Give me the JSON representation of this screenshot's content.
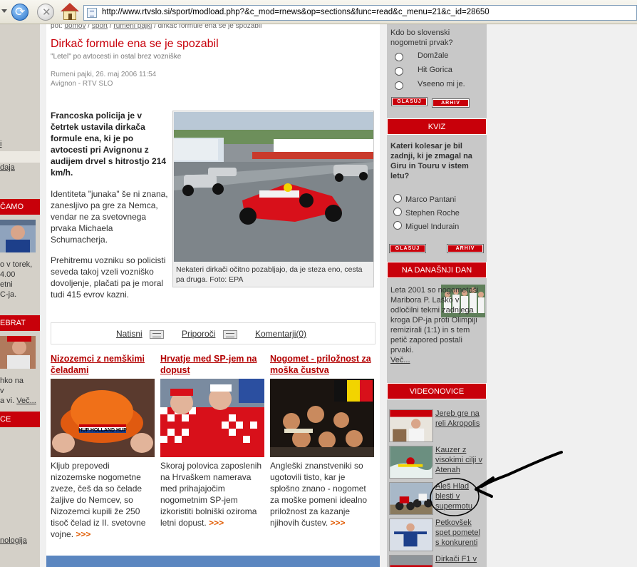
{
  "browser": {
    "url": "http://www.rtvslo.si/sport/modload.php?&c_mod=rnews&op=sections&func=read&c_menu=21&c_id=28650"
  },
  "left": {
    "link1": "i",
    "link2": "daja",
    "bar1": "ČAMO",
    "text1": [
      "o v torek,",
      "4.00",
      "etni",
      "C-ja."
    ],
    "bar2": "EBRAT",
    "text2": [
      "hko na",
      "v",
      "a vi."
    ],
    "text2_more": "Več...",
    "bar3": "CE",
    "link3": "nologija"
  },
  "breadcrumb": {
    "prefix": "pot:",
    "items": [
      "domov",
      "šport",
      "rumeni pajki"
    ],
    "current": "dirkač formule ena se je spozabil"
  },
  "article": {
    "title": "Dirkač formule ena se je spozabil",
    "subtitle": "\"Letel\" po avtocesti in ostal brez vozniške",
    "meta_line1": "Rumeni pajki, 26. maj 2006 11:54",
    "meta_line2": "Avignon - RTV SLO",
    "lead": "Francoska policija je v četrtek ustavila dirkača formule ena, ki je po avtocesti pri Avignonu z audijem drvel s hitrostjo 214 km/h.",
    "p1": "Identiteta \"junaka\" še ni znana, zanesljivo pa gre za Nemca, vendar ne za svetovnega prvaka Michaela Schumacherja.",
    "p2": "Prehitremu vozniku so policisti seveda takoj vzeli vozniško dovoljenje, plačati pa je moral tudi 415 evrov kazni.",
    "caption": "Nekateri dirkači očitno pozabljajo, da je steza eno, cesta pa druga. Foto: EPA"
  },
  "tools": {
    "print": "Natisni",
    "recommend": "Priporoči",
    "comments": "Komentarji(0)"
  },
  "stories": [
    {
      "title": "Nizozemci z nemškimi čeladami",
      "text": "Kljub prepovedi nizozemske nogometne zveze, češ da so čelade žaljive do Nemcev, so Nizozemci kupili že 250 tisoč čelad iz II. svetovne vojne.",
      "more": ">>>",
      "helmet_text": "HUP HOLLAND HUP"
    },
    {
      "title": "Hrvatje med SP-jem na dopust",
      "text": "Skoraj polovica zaposlenih na Hrvaškem namerava med prihajajočim nogometnim SP-jem izkoristiti bolniški oziroma letni dopust.",
      "more": ">>>"
    },
    {
      "title": "Nogomet - priložnost za moška čustva",
      "text": "Angleški znanstveniki so ugotovili tisto, kar je splošno znano - nogomet za moške pomeni idealno priložnost za kazanje njihovih čustev.",
      "more": ">>>"
    }
  ],
  "poll1": {
    "question": "Kdo bo slovenski nogometni prvak?",
    "options": [
      "Domžale",
      "Hit Gorica",
      "Vseeno mi je."
    ],
    "vote": "GLASUJ",
    "archive": "ARHIV"
  },
  "quiz": {
    "header": "KVIZ",
    "question": "Kateri kolesar je bil zadnji, ki je zmagal na Giru in Touru v istem letu?",
    "options": [
      "Marco Pantani",
      "Stephen Roche",
      "Miguel Indurain"
    ],
    "vote": "GLASUJ",
    "archive": "ARHIV"
  },
  "today": {
    "header": "NA DANAŠNJI DAN",
    "text": "Leta 2001 so nogometaši Maribora P. Laško v odločilni tekmi zadnjega kroga DP-ja proti Olimpiji remizirali (1:1) in s tem petič zapored postali prvaki.",
    "more": "Več..."
  },
  "video": {
    "header": "VIDEONOVICE",
    "items": [
      "Jereb gre na reli Akropolis",
      "Kauzer z visokimi cilji v Atenah",
      "Aleš Hlad blesti v supermotu",
      "Petkovšek spet pometel s konkurenti",
      "Dirkači F1 v"
    ]
  },
  "colors": {
    "brand_red": "#c8000a",
    "link_red": "#b30000",
    "more_orange": "#e05a00"
  }
}
